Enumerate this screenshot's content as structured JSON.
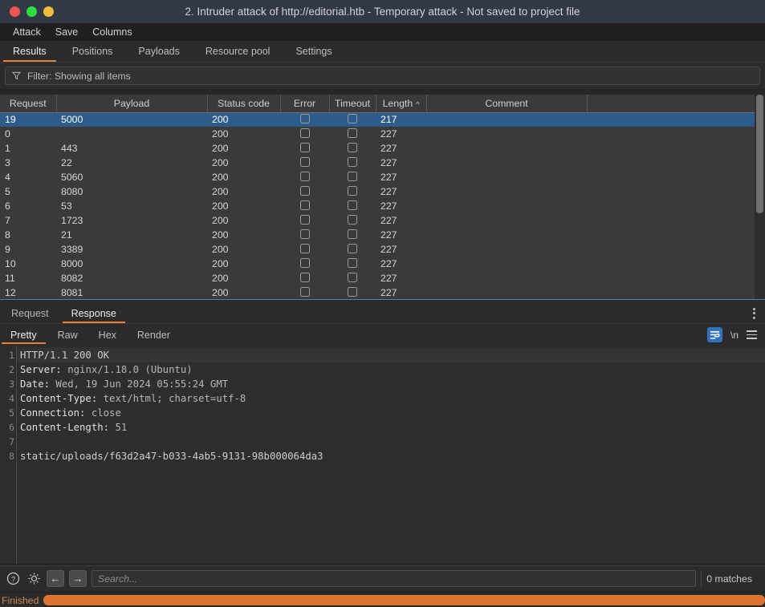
{
  "window": {
    "title": "2. Intruder attack of http://editorial.htb - Temporary attack - Not saved to project file",
    "controls": {
      "close": "close-button",
      "minimize": "minimize-button",
      "maximize": "maximize-button"
    }
  },
  "menubar": {
    "items": [
      "Attack",
      "Save",
      "Columns"
    ]
  },
  "main_tabs": {
    "items": [
      "Results",
      "Positions",
      "Payloads",
      "Resource pool",
      "Settings"
    ],
    "active": "Results"
  },
  "filter": {
    "label": "Filter: Showing all items",
    "icon": "funnel-icon"
  },
  "results_table": {
    "columns": [
      "Request",
      "Payload",
      "Status code",
      "Error",
      "Timeout",
      "Length",
      "Comment"
    ],
    "sorted_column": "Length",
    "sort_direction": "ascending",
    "rows": [
      {
        "request": "19",
        "payload": "5000",
        "status": "200",
        "error": false,
        "timeout": false,
        "length": "217",
        "comment": "",
        "selected": true
      },
      {
        "request": "0",
        "payload": "",
        "status": "200",
        "error": false,
        "timeout": false,
        "length": "227",
        "comment": "",
        "selected": false
      },
      {
        "request": "1",
        "payload": "443",
        "status": "200",
        "error": false,
        "timeout": false,
        "length": "227",
        "comment": "",
        "selected": false
      },
      {
        "request": "3",
        "payload": "22",
        "status": "200",
        "error": false,
        "timeout": false,
        "length": "227",
        "comment": "",
        "selected": false
      },
      {
        "request": "4",
        "payload": "5060",
        "status": "200",
        "error": false,
        "timeout": false,
        "length": "227",
        "comment": "",
        "selected": false
      },
      {
        "request": "5",
        "payload": "8080",
        "status": "200",
        "error": false,
        "timeout": false,
        "length": "227",
        "comment": "",
        "selected": false
      },
      {
        "request": "6",
        "payload": "53",
        "status": "200",
        "error": false,
        "timeout": false,
        "length": "227",
        "comment": "",
        "selected": false
      },
      {
        "request": "7",
        "payload": "1723",
        "status": "200",
        "error": false,
        "timeout": false,
        "length": "227",
        "comment": "",
        "selected": false
      },
      {
        "request": "8",
        "payload": "21",
        "status": "200",
        "error": false,
        "timeout": false,
        "length": "227",
        "comment": "",
        "selected": false
      },
      {
        "request": "9",
        "payload": "3389",
        "status": "200",
        "error": false,
        "timeout": false,
        "length": "227",
        "comment": "",
        "selected": false
      },
      {
        "request": "10",
        "payload": "8000",
        "status": "200",
        "error": false,
        "timeout": false,
        "length": "227",
        "comment": "",
        "selected": false
      },
      {
        "request": "11",
        "payload": "8082",
        "status": "200",
        "error": false,
        "timeout": false,
        "length": "227",
        "comment": "",
        "selected": false
      },
      {
        "request": "12",
        "payload": "8081",
        "status": "200",
        "error": false,
        "timeout": false,
        "length": "227",
        "comment": "",
        "selected": false
      }
    ]
  },
  "message_tabs": {
    "items": [
      "Request",
      "Response"
    ],
    "active": "Response",
    "menu_icon": "kebab-menu-icon"
  },
  "view_tabs": {
    "items": [
      "Pretty",
      "Raw",
      "Hex",
      "Render"
    ],
    "active": "Pretty",
    "tools": {
      "wrap_icon": "word-wrap-icon",
      "newline_label": "\\n",
      "menu_icon": "hamburger-menu-icon"
    }
  },
  "response": {
    "lines": [
      {
        "n": "1",
        "text": "HTTP/1.1 200 OK"
      },
      {
        "n": "2",
        "text": "Server: nginx/1.18.0 (Ubuntu)"
      },
      {
        "n": "3",
        "text": "Date: Wed, 19 Jun 2024 05:55:24 GMT"
      },
      {
        "n": "4",
        "text": "Content-Type: text/html; charset=utf-8"
      },
      {
        "n": "5",
        "text": "Connection: close"
      },
      {
        "n": "6",
        "text": "Content-Length: 51"
      },
      {
        "n": "7",
        "text": ""
      },
      {
        "n": "8",
        "text": "static/uploads/f63d2a47-b033-4ab5-9131-98b000064da3"
      }
    ]
  },
  "search": {
    "help_icon": "help-icon",
    "settings_icon": "gear-icon",
    "prev_icon": "arrow-left-icon",
    "next_icon": "arrow-right-icon",
    "placeholder": "Search...",
    "value": "",
    "matches": "0 matches"
  },
  "status": {
    "label": "Finished",
    "progress_percent": 100
  },
  "colors": {
    "accent": "#e8803a",
    "selection": "#2e5c8a",
    "titlebar": "#333846",
    "panel": "#2b2b2b",
    "table": "#3a3a3a",
    "editor": "#2d2d2d",
    "progress": "#e0732e",
    "wrap_active": "#2f72c4"
  }
}
